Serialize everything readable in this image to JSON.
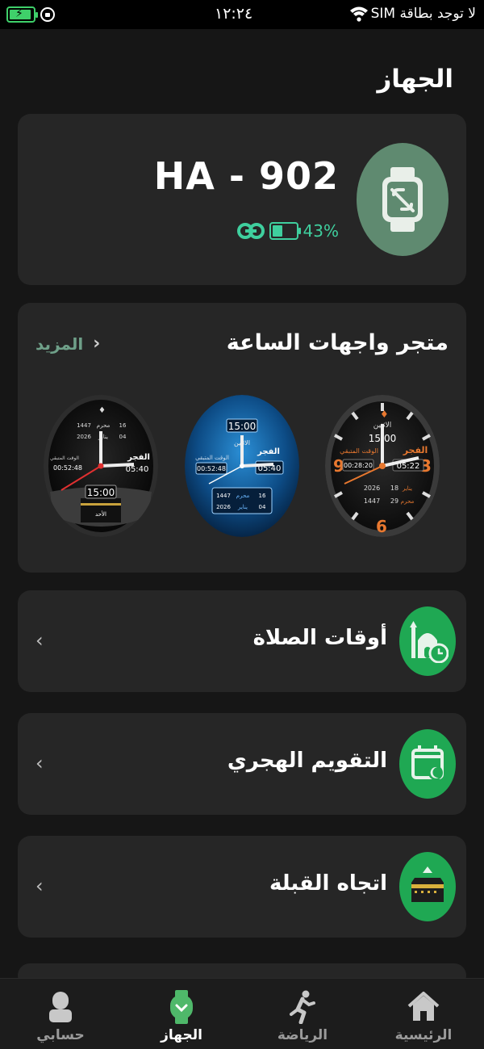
{
  "status_bar": {
    "time": "١٢:٢٤",
    "carrier": "لا توجد بطاقة SIM"
  },
  "header": {
    "title": "الجهاز"
  },
  "device": {
    "name": "HA - 902",
    "battery_percent": "43%",
    "battery_level": 0.43,
    "icon": "watch-disconnected-icon"
  },
  "watch_store": {
    "title": "متجر واجهات الساعة",
    "more_label": "المزيد",
    "faces": [
      {
        "id": "face-1",
        "prayer_name": "الفجر",
        "prayer_time": "05:22",
        "next_label": "الاثنين",
        "digital_time": "15:00",
        "countdown_label": "الوقت المتبقي",
        "countdown": "00:28:20",
        "greg_year": "2026",
        "greg_day": "18",
        "greg_month": "يناير",
        "hijri_year": "1447",
        "hijri_day": "29",
        "hijri_month": "محرم",
        "numerals": [
          "9",
          "3",
          "6"
        ]
      },
      {
        "id": "face-2",
        "prayer_name": "الفجر",
        "prayer_time": "05:40",
        "next_label": "الاثنين",
        "digital_time": "15:00",
        "countdown_label": "الوقت المتبقي",
        "countdown": "00:52:48",
        "hijri_year": "1447",
        "hijri_day": "16",
        "hijri_month": "محرم",
        "greg_year": "2026",
        "greg_day": "04",
        "greg_month": "يناير"
      },
      {
        "id": "face-3",
        "prayer_name": "الفجر",
        "prayer_time": "05:40",
        "digital_time": "15:00",
        "day_name": "الأحد",
        "countdown_label": "الوقت المتبقي",
        "countdown": "00:52:48",
        "hijri_year": "1447",
        "hijri_day": "16",
        "hijri_month": "محرم",
        "greg_year": "2026",
        "greg_day": "04",
        "greg_month": "يناير"
      }
    ]
  },
  "features": [
    {
      "label": "أوقات الصلاة",
      "icon": "mosque-clock-icon"
    },
    {
      "label": "التقويم الهجري",
      "icon": "calendar-moon-icon"
    },
    {
      "label": "اتجاه القبلة",
      "icon": "kaaba-icon"
    }
  ],
  "bottom_nav": {
    "items": [
      {
        "label": "حسابي",
        "icon": "person-icon"
      },
      {
        "label": "الجهاز",
        "icon": "watch-icon",
        "active": true
      },
      {
        "label": "الرياضة",
        "icon": "running-icon"
      },
      {
        "label": "الرئيسية",
        "icon": "home-icon"
      }
    ]
  },
  "colors": {
    "accent_green": "#1fa853",
    "teal": "#3fcf9e",
    "device_avatar": "#5f8a70",
    "card_bg": "#262626",
    "page_bg": "#161616"
  }
}
